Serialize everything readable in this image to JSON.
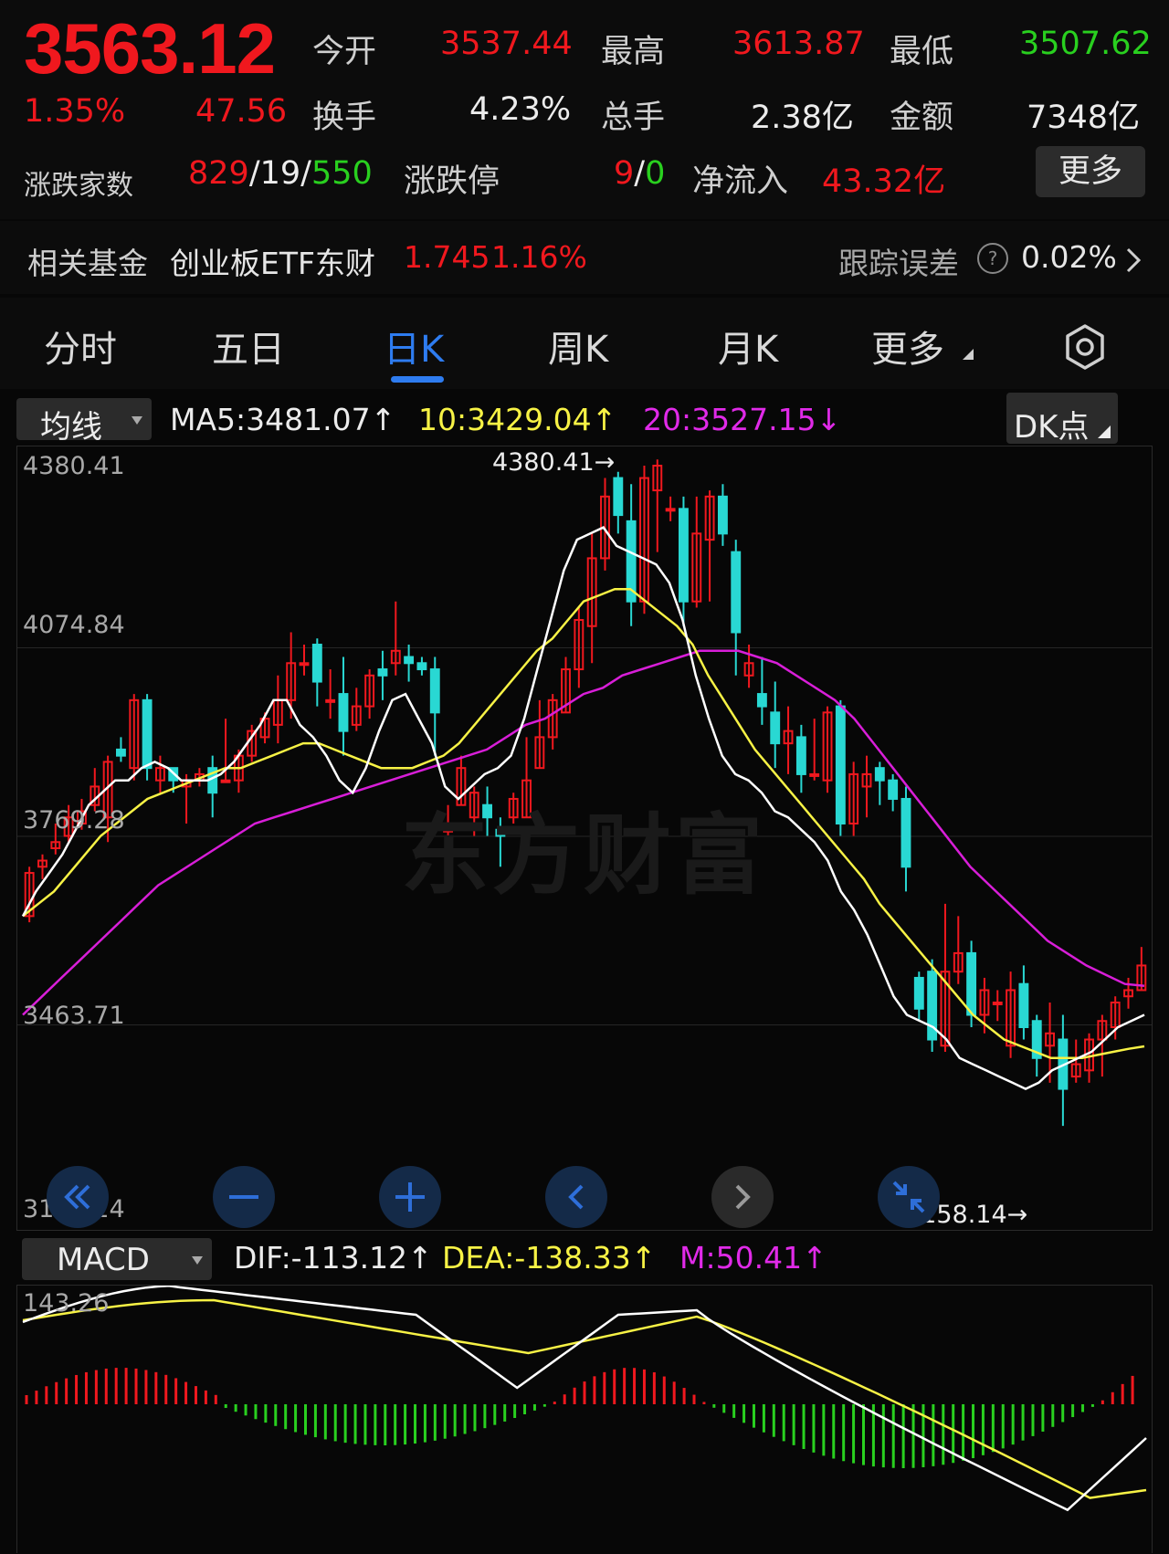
{
  "quote": {
    "price": "3563.12",
    "change_pct": "1.35%",
    "change": "47.56",
    "open_label": "今开",
    "open": "3537.44",
    "high_label": "最高",
    "high": "3613.87",
    "low_label": "最低",
    "low": "3507.62",
    "turnover_label": "换手",
    "turnover": "4.23%",
    "volume_label": "总手",
    "volume": "2.38亿",
    "amount_label": "金额",
    "amount": "7348亿",
    "advdec_label": "涨跌家数",
    "adv": "829",
    "flat": "19",
    "dec": "550",
    "slash": "/",
    "limit_label": "涨跌停",
    "limit_up": "9",
    "limit_down": "0",
    "netflow_label": "净流入",
    "netflow": "43.32亿",
    "more_label": "更多"
  },
  "fund": {
    "label": "相关基金",
    "name": "创业板ETF东财",
    "price": "1.745",
    "pct": "1.16%",
    "track_label": "跟踪误差",
    "help": "?",
    "track_value": "0.02%"
  },
  "tabs": [
    {
      "label": "分时"
    },
    {
      "label": "五日"
    },
    {
      "label": "日K"
    },
    {
      "label": "周K"
    },
    {
      "label": "月K"
    },
    {
      "label": "更多"
    }
  ],
  "indicator": {
    "select_label": "均线",
    "ma5": "MA5:3481.07↑",
    "ma10": "10:3429.04↑",
    "ma20": "20:3527.15↓",
    "dk_label": "DK点"
  },
  "price_axis": [
    "4380.41",
    "4074.84",
    "3769.28",
    "3463.71",
    "3158.14"
  ],
  "annotations": {
    "high": "4380.41→",
    "low": "3158.14→"
  },
  "watermark": "东方财富",
  "macd": {
    "select_label": "MACD",
    "dif": "DIF:-113.12↑",
    "dea": "DEA:-138.33↑",
    "m": "M:50.41↑",
    "axis_top": "143.26"
  },
  "colors": {
    "up": "#f0181e",
    "down": "#29d8d3",
    "ma5": "#ffffff",
    "ma10": "#f7f245",
    "ma20": "#d81ed8",
    "accent": "#2e7cf0"
  },
  "icons": [
    "double-left-icon",
    "minus-icon",
    "plus-icon",
    "left-icon",
    "right-icon",
    "shrink-icon",
    "gear-icon",
    "chevron-right-icon"
  ],
  "chart_data": {
    "type": "candlestick",
    "ylim": [
      3158.14,
      4380.41
    ],
    "candles": [
      [
        3640,
        3710,
        3630,
        3720
      ],
      [
        3720,
        3730,
        3700,
        3740
      ],
      [
        3750,
        3760,
        3740,
        3790
      ],
      [
        3770,
        3800,
        3760,
        3820
      ],
      [
        3790,
        3810,
        3780,
        3830
      ],
      [
        3820,
        3850,
        3810,
        3880
      ],
      [
        3800,
        3890,
        3760,
        3900
      ],
      [
        3910,
        3900,
        3890,
        3930
      ],
      [
        3880,
        3990,
        3860,
        4000
      ],
      [
        3990,
        3880,
        3860,
        4000
      ],
      [
        3860,
        3880,
        3840,
        3900
      ],
      [
        3880,
        3860,
        3840,
        3880
      ],
      [
        3850,
        3860,
        3790,
        3870
      ],
      [
        3860,
        3870,
        3850,
        3880
      ],
      [
        3880,
        3840,
        3800,
        3900
      ],
      [
        3860,
        3860,
        3860,
        3960
      ],
      [
        3860,
        3900,
        3840,
        3910
      ],
      [
        3900,
        3940,
        3890,
        3950
      ],
      [
        3930,
        3960,
        3920,
        3970
      ],
      [
        3950,
        3990,
        3920,
        4030
      ],
      [
        3990,
        4050,
        3960,
        4100
      ],
      [
        4050,
        4050,
        4030,
        4080
      ],
      [
        4080,
        4020,
        3980,
        4090
      ],
      [
        3990,
        3990,
        3960,
        4040
      ],
      [
        4000,
        3940,
        3900,
        4060
      ],
      [
        3950,
        3980,
        3940,
        4010
      ],
      [
        3980,
        4030,
        3960,
        4040
      ],
      [
        4040,
        4030,
        3990,
        4070
      ],
      [
        4050,
        4070,
        4030,
        4150
      ],
      [
        4060,
        4050,
        4020,
        4080
      ],
      [
        4050,
        4040,
        4030,
        4060
      ],
      [
        4040,
        3970,
        3900,
        4060
      ],
      [
        3780,
        3780,
        3760,
        3820
      ],
      [
        3820,
        3880,
        3820,
        3900
      ],
      [
        3800,
        3840,
        3770,
        3850
      ],
      [
        3820,
        3800,
        3770,
        3850
      ],
      [
        3780,
        3770,
        3720,
        3800
      ],
      [
        3800,
        3830,
        3790,
        3840
      ],
      [
        3800,
        3860,
        3800,
        3930
      ],
      [
        3880,
        3930,
        3880,
        3990
      ],
      [
        3930,
        3990,
        3910,
        4000
      ],
      [
        3970,
        4040,
        3970,
        4060
      ],
      [
        4040,
        4120,
        4010,
        4140
      ],
      [
        4110,
        4220,
        4050,
        4260
      ],
      [
        4220,
        4320,
        4200,
        4350
      ],
      [
        4350,
        4290,
        4260,
        4360
      ],
      [
        4280,
        4150,
        4110,
        4340
      ],
      [
        4150,
        4350,
        4130,
        4370
      ],
      [
        4330,
        4370,
        4230,
        4380
      ],
      [
        4300,
        4300,
        4280,
        4320
      ],
      [
        4300,
        4150,
        4110,
        4320
      ],
      [
        4150,
        4260,
        4140,
        4320
      ],
      [
        4250,
        4320,
        4150,
        4330
      ],
      [
        4320,
        4260,
        4240,
        4340
      ],
      [
        4230,
        4100,
        4030,
        4250
      ],
      [
        4030,
        4050,
        4010,
        4080
      ],
      [
        4000,
        3980,
        3950,
        4060
      ],
      [
        3970,
        3920,
        3880,
        4020
      ],
      [
        3920,
        3940,
        3870,
        3980
      ],
      [
        3930,
        3870,
        3840,
        3950
      ],
      [
        3870,
        3870,
        3860,
        3960
      ],
      [
        3860,
        3970,
        3840,
        3980
      ],
      [
        3980,
        3790,
        3770,
        3990
      ],
      [
        3790,
        3870,
        3770,
        3890
      ],
      [
        3850,
        3870,
        3800,
        3900
      ],
      [
        3880,
        3860,
        3820,
        3890
      ],
      [
        3860,
        3830,
        3810,
        3870
      ],
      [
        3830,
        3720,
        3680,
        3850
      ],
      [
        3540,
        3490,
        3470,
        3550
      ],
      [
        3550,
        3440,
        3420,
        3570
      ],
      [
        3430,
        3550,
        3420,
        3660
      ],
      [
        3550,
        3580,
        3530,
        3640
      ],
      [
        3580,
        3480,
        3460,
        3600
      ],
      [
        3480,
        3520,
        3450,
        3540
      ],
      [
        3500,
        3500,
        3470,
        3520
      ],
      [
        3430,
        3520,
        3410,
        3550
      ],
      [
        3530,
        3460,
        3440,
        3560
      ],
      [
        3470,
        3410,
        3380,
        3480
      ],
      [
        3430,
        3450,
        3370,
        3500
      ],
      [
        3440,
        3360,
        3300,
        3480
      ],
      [
        3380,
        3400,
        3370,
        3440
      ],
      [
        3390,
        3440,
        3370,
        3450
      ],
      [
        3440,
        3470,
        3380,
        3480
      ],
      [
        3460,
        3500,
        3440,
        3510
      ],
      [
        3510,
        3520,
        3490,
        3540
      ],
      [
        3520,
        3560,
        3520,
        3590
      ]
    ],
    "ma5": [
      3640,
      3680,
      3710,
      3740,
      3780,
      3820,
      3840,
      3860,
      3860,
      3880,
      3890,
      3880,
      3860,
      3860,
      3860,
      3870,
      3890,
      3920,
      3950,
      3990,
      3990,
      3950,
      3930,
      3900,
      3860,
      3840,
      3880,
      3940,
      3990,
      4000,
      3960,
      3920,
      3850,
      3830,
      3850,
      3870,
      3880,
      3900,
      3960,
      4040,
      4120,
      4200,
      4250,
      4260,
      4270,
      4240,
      4230,
      4220,
      4210,
      4180,
      4120,
      4030,
      3960,
      3900,
      3870,
      3860,
      3840,
      3810,
      3800,
      3780,
      3760,
      3730,
      3680,
      3650,
      3610,
      3560,
      3510,
      3480,
      3470,
      3460,
      3440,
      3410,
      3400,
      3390,
      3380,
      3370,
      3360,
      3370,
      3390,
      3400,
      3410,
      3420,
      3440,
      3460,
      3470,
      3480
    ],
    "ma10": [
      3640,
      3660,
      3680,
      3710,
      3740,
      3770,
      3790,
      3810,
      3830,
      3840,
      3850,
      3860,
      3870,
      3880,
      3880,
      3890,
      3900,
      3910,
      3920,
      3920,
      3910,
      3900,
      3890,
      3880,
      3880,
      3880,
      3890,
      3900,
      3920,
      3950,
      3980,
      4010,
      4040,
      4070,
      4090,
      4120,
      4150,
      4160,
      4170,
      4170,
      4150,
      4130,
      4110,
      4080,
      4030,
      3990,
      3950,
      3910,
      3880,
      3850,
      3820,
      3790,
      3760,
      3730,
      3700,
      3660,
      3630,
      3600,
      3570,
      3540,
      3510,
      3480,
      3460,
      3440,
      3430,
      3420,
      3410,
      3410,
      3410,
      3415,
      3420,
      3425,
      3429
    ],
    "ma20": [
      3480,
      3510,
      3540,
      3570,
      3600,
      3630,
      3660,
      3690,
      3710,
      3730,
      3750,
      3770,
      3790,
      3800,
      3810,
      3820,
      3830,
      3840,
      3850,
      3860,
      3870,
      3880,
      3890,
      3900,
      3910,
      3930,
      3950,
      3960,
      3980,
      4000,
      4010,
      4030,
      4040,
      4050,
      4060,
      4070,
      4070,
      4070,
      4060,
      4050,
      4030,
      4010,
      3990,
      3960,
      3920,
      3880,
      3840,
      3800,
      3760,
      3720,
      3690,
      3660,
      3630,
      3600,
      3580,
      3560,
      3545,
      3530,
      3527
    ],
    "macd": {
      "dif_last": -113.12,
      "dea_last": -138.33,
      "m_last": 50.41,
      "top": 143.26
    }
  }
}
